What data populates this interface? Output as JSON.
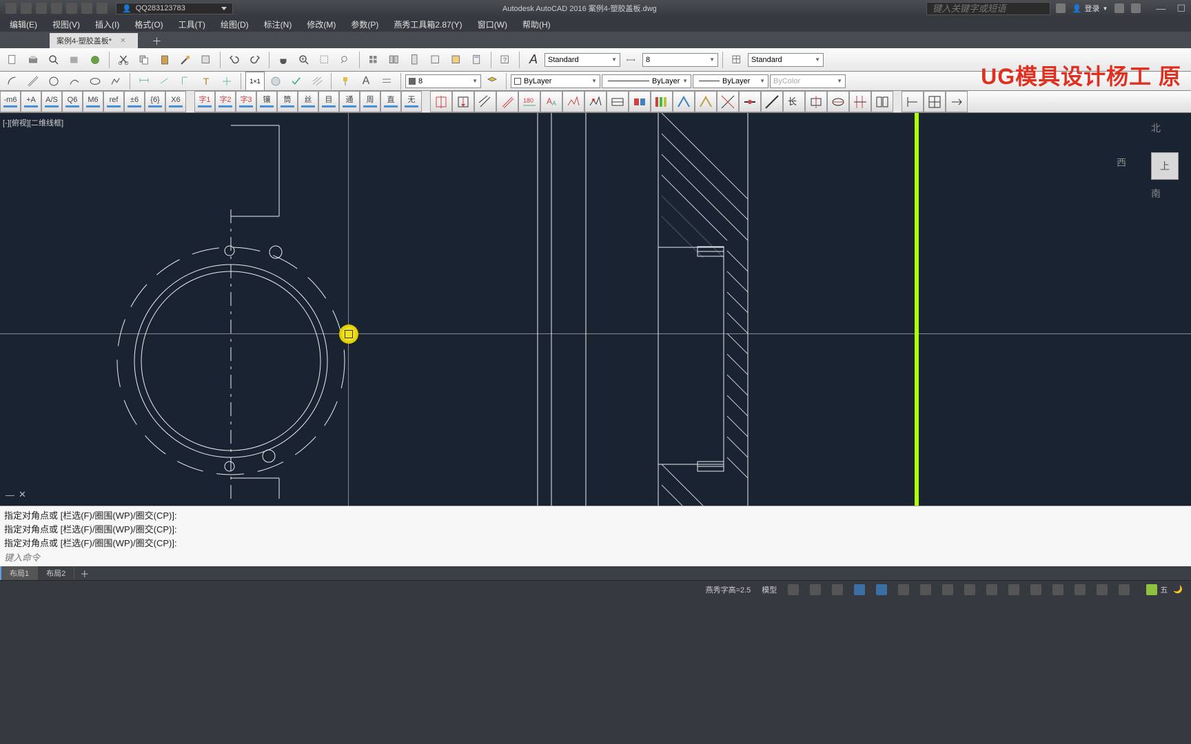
{
  "app": {
    "qq": "QQ283123783",
    "title": "Autodesk AutoCAD 2016    案例4-塑胶盖板.dwg",
    "search_placeholder": "键入关键字或短语",
    "login": "登录"
  },
  "menus": [
    "编辑(E)",
    "视图(V)",
    "插入(I)",
    "格式(O)",
    "工具(T)",
    "绘图(D)",
    "标注(N)",
    "修改(M)",
    "参数(P)",
    "燕秀工具箱2.87(Y)",
    "窗口(W)",
    "帮助(H)"
  ],
  "doctab": {
    "label": "案例4-塑胶盖板*"
  },
  "styles": {
    "text_style": "Standard",
    "dim_value": "8",
    "table_style": "Standard",
    "current_layer": "8",
    "linetype": "ByLayer",
    "lineweight": "ByLayer",
    "plotstyle": "ByColor",
    "color": "ByLayer"
  },
  "custom_buttons_left": [
    "-m6",
    "+A",
    "A/S",
    "Q6",
    "M6",
    "ref",
    "±6",
    "{6}",
    "X6"
  ],
  "custom_buttons_mid": [
    "字1",
    "字2",
    "字3",
    "镶",
    "筒",
    "丝",
    "目",
    "通",
    "周",
    "直",
    "无"
  ],
  "viewport_label": "[-][俯视][二维线框]",
  "viewcube": {
    "north": "北",
    "south": "南",
    "west": "西",
    "top": "上"
  },
  "cmd_history": [
    "指定对角点或 [栏选(F)/圈围(WP)/圈交(CP)]:",
    "指定对角点或 [栏选(F)/圈围(WP)/圈交(CP)]:",
    "指定对角点或 [栏选(F)/圈围(WP)/圈交(CP)]:"
  ],
  "cmd_input_placeholder": "键入命令",
  "layout_tabs": [
    "布局1",
    "布局2"
  ],
  "status": {
    "yanxiu": "燕秀字高=2.5",
    "mode": "模型",
    "ime": "五"
  },
  "watermark": "UG模具设计杨工 原"
}
